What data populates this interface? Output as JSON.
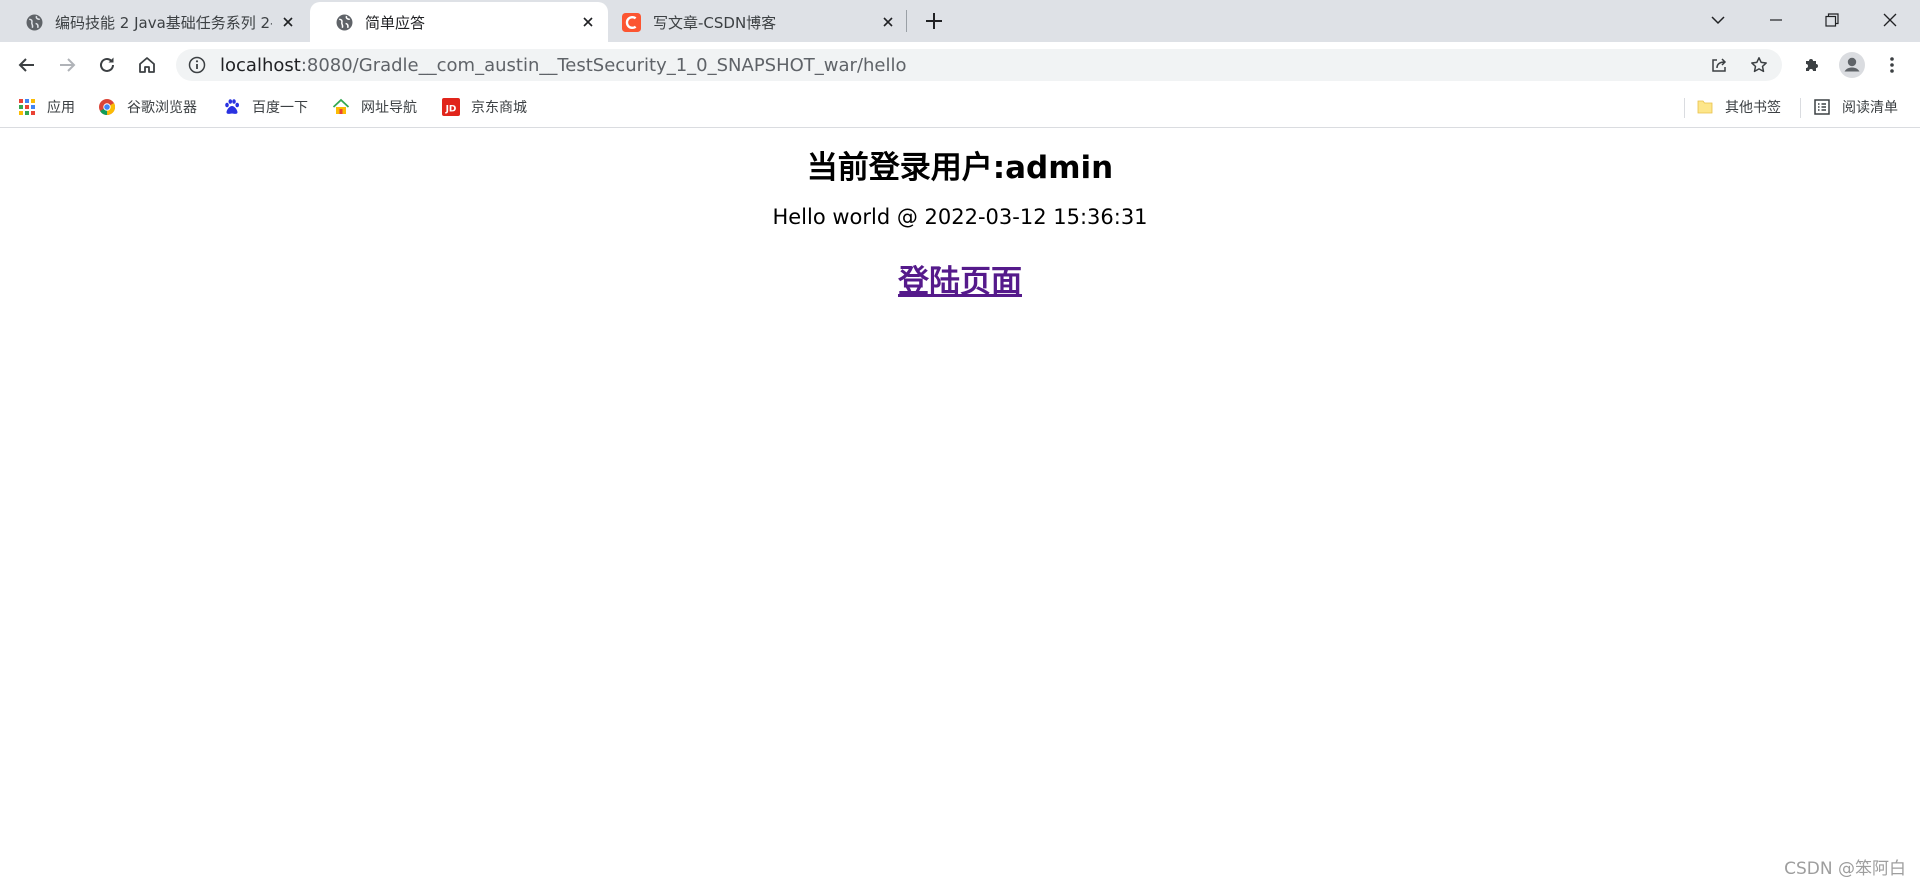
{
  "browser": {
    "tabs": [
      {
        "title": "编码技能 2 Java基础任务系列 2-",
        "active": false,
        "favicon": "globe-icon"
      },
      {
        "title": "简单应答",
        "active": true,
        "favicon": "globe-icon"
      },
      {
        "title": "写文章-CSDN博客",
        "active": false,
        "favicon": "csdn-logo-icon"
      }
    ],
    "address": {
      "host": "localhost",
      "rest": ":8080/Gradle__com_austin__TestSecurity_1_0_SNAPSHOT_war/hello"
    },
    "bookmarks": [
      {
        "label": "应用",
        "icon": "apps-grid-icon"
      },
      {
        "label": "谷歌浏览器",
        "icon": "chrome-icon"
      },
      {
        "label": "百度一下",
        "icon": "baidu-paw-icon"
      },
      {
        "label": "网址导航",
        "icon": "home-nav-icon"
      },
      {
        "label": "京东商城",
        "icon": "jd-logo-icon"
      }
    ],
    "other_bookmarks": "其他书签",
    "reading_list": "阅读清单"
  },
  "page": {
    "heading": "当前登录用户:admin",
    "hello": "Hello world @ 2022-03-12 15:36:31",
    "login_link": "登陆页面"
  },
  "watermark": "CSDN @笨阿白",
  "colors": {
    "tab_strip": "#dee1e6",
    "visited_link": "#551a8b",
    "csdn_red": "#fc5531",
    "jd_red": "#e1251b"
  }
}
